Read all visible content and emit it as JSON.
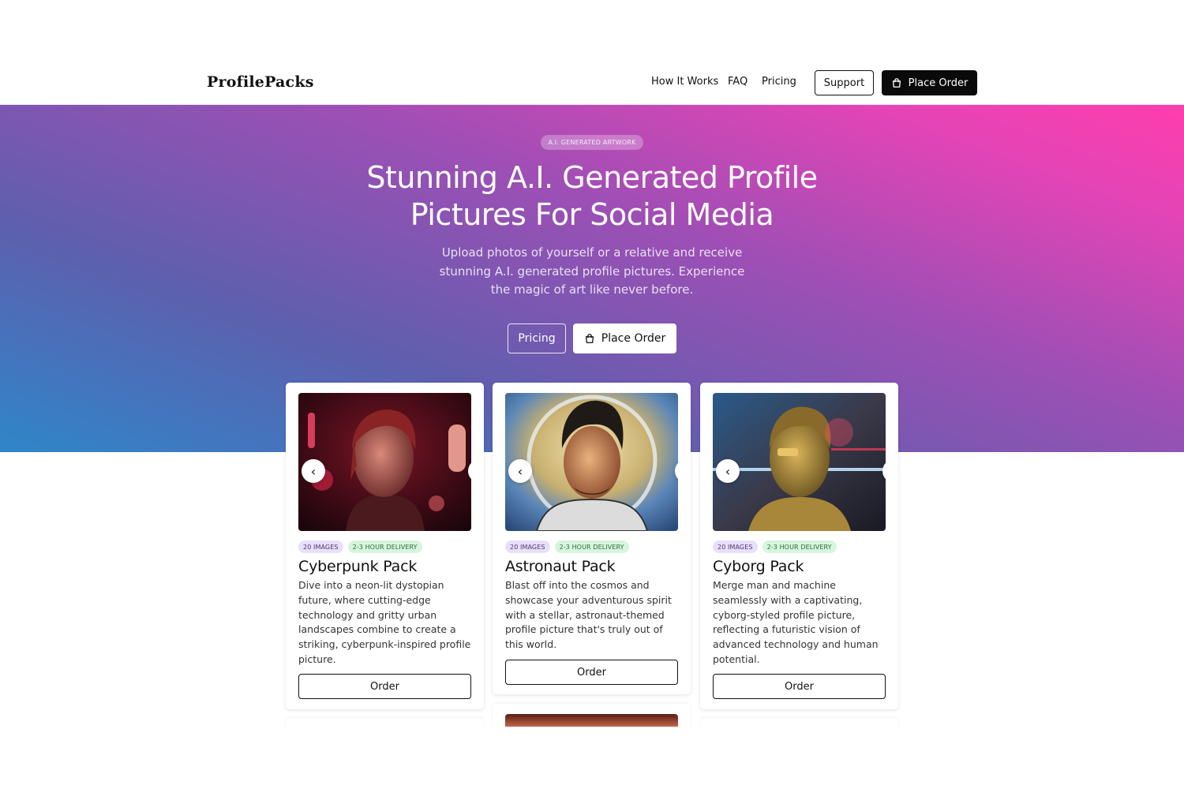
{
  "nav": {
    "logo": "ProfilePacks",
    "links": [
      "How It Works",
      "FAQ",
      "Pricing"
    ],
    "support_label": "Support",
    "order_label": "Place Order"
  },
  "hero": {
    "badge": "A.I. GENERATED ARTWORK",
    "title_line1": "Stunning A.I. Generated Profile",
    "title_line2": "Pictures For Social Media",
    "subtitle_line1": "Upload photos of yourself or a relative and receive",
    "subtitle_line2": "stunning A.I. generated profile pictures. Experience",
    "subtitle_line3": "the magic of art like never before.",
    "pricing_label": "Pricing",
    "order_label": "Place Order"
  },
  "cards": [
    {
      "tag_images": "20 IMAGES",
      "tag_delivery": "2-3 HOUR DELIVERY",
      "title": "Cyberpunk Pack",
      "description": "Dive into a neon-lit dystopian future, where cutting-edge technology and gritty urban landscapes combine to create a striking, cyberpunk-inspired profile picture.",
      "button": "Order"
    },
    {
      "tag_images": "20 IMAGES",
      "tag_delivery": "2-3 HOUR DELIVERY",
      "title": "Astronaut Pack",
      "description": "Blast off into the cosmos and showcase your adventurous spirit with a stellar, astronaut-themed profile picture that's truly out of this world.",
      "button": "Order"
    },
    {
      "tag_images": "20 IMAGES",
      "tag_delivery": "2-3 HOUR DELIVERY",
      "title": "Cyborg Pack",
      "description": "Merge man and machine seamlessly with a captivating, cyborg-styled profile picture, reflecting a futuristic vision of advanced technology and human potential.",
      "button": "Order"
    }
  ],
  "icons": {
    "bag": "shopping-bag-icon",
    "prev": "chevron-left-icon",
    "next": "chevron-right-icon"
  },
  "colors": {
    "nav_button_bg": "#0a0a0a",
    "hero_gradient_start": "#2f86c9",
    "hero_gradient_end": "#ff3dae",
    "tag_images_bg": "#e9defb",
    "tag_delivery_bg": "#d6f5dc"
  }
}
